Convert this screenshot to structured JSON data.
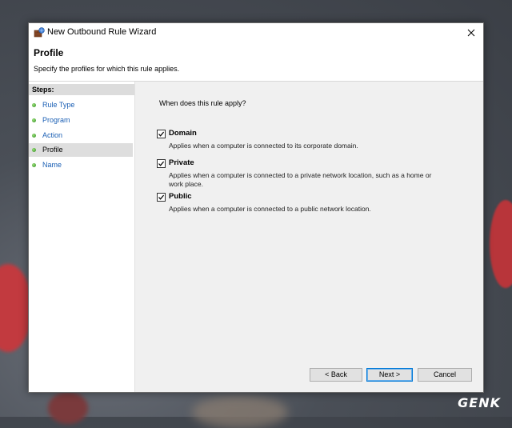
{
  "window": {
    "title": "New Outbound Rule Wizard"
  },
  "header": {
    "title": "Profile",
    "subtitle": "Specify the profiles for which this rule applies."
  },
  "steps": {
    "heading": "Steps:",
    "items": [
      {
        "label": "Rule Type"
      },
      {
        "label": "Program"
      },
      {
        "label": "Action"
      },
      {
        "label": "Profile"
      },
      {
        "label": "Name"
      }
    ],
    "active_step": "Profile"
  },
  "main": {
    "question": "When does this rule apply?",
    "options": [
      {
        "title": "Domain",
        "checked": true,
        "description": "Applies when a computer is connected to its corporate domain."
      },
      {
        "title": "Private",
        "checked": true,
        "description": "Applies when a computer is connected to a private network location, such as a home or work place."
      },
      {
        "title": "Public",
        "checked": true,
        "description": "Applies when a computer is connected to a public network location."
      }
    ]
  },
  "buttons": {
    "back": "< Back",
    "next": "Next >",
    "cancel": "Cancel"
  },
  "watermark": "GENK",
  "colors": {
    "accent": "#0078d7",
    "step_link": "#1a5fb4",
    "step_dot": "#3a9a28"
  },
  "icons": {
    "title": "firewall-wizard-icon",
    "close": "close-icon",
    "step": "green-dot-icon",
    "checkbox": "checkmark-icon"
  }
}
